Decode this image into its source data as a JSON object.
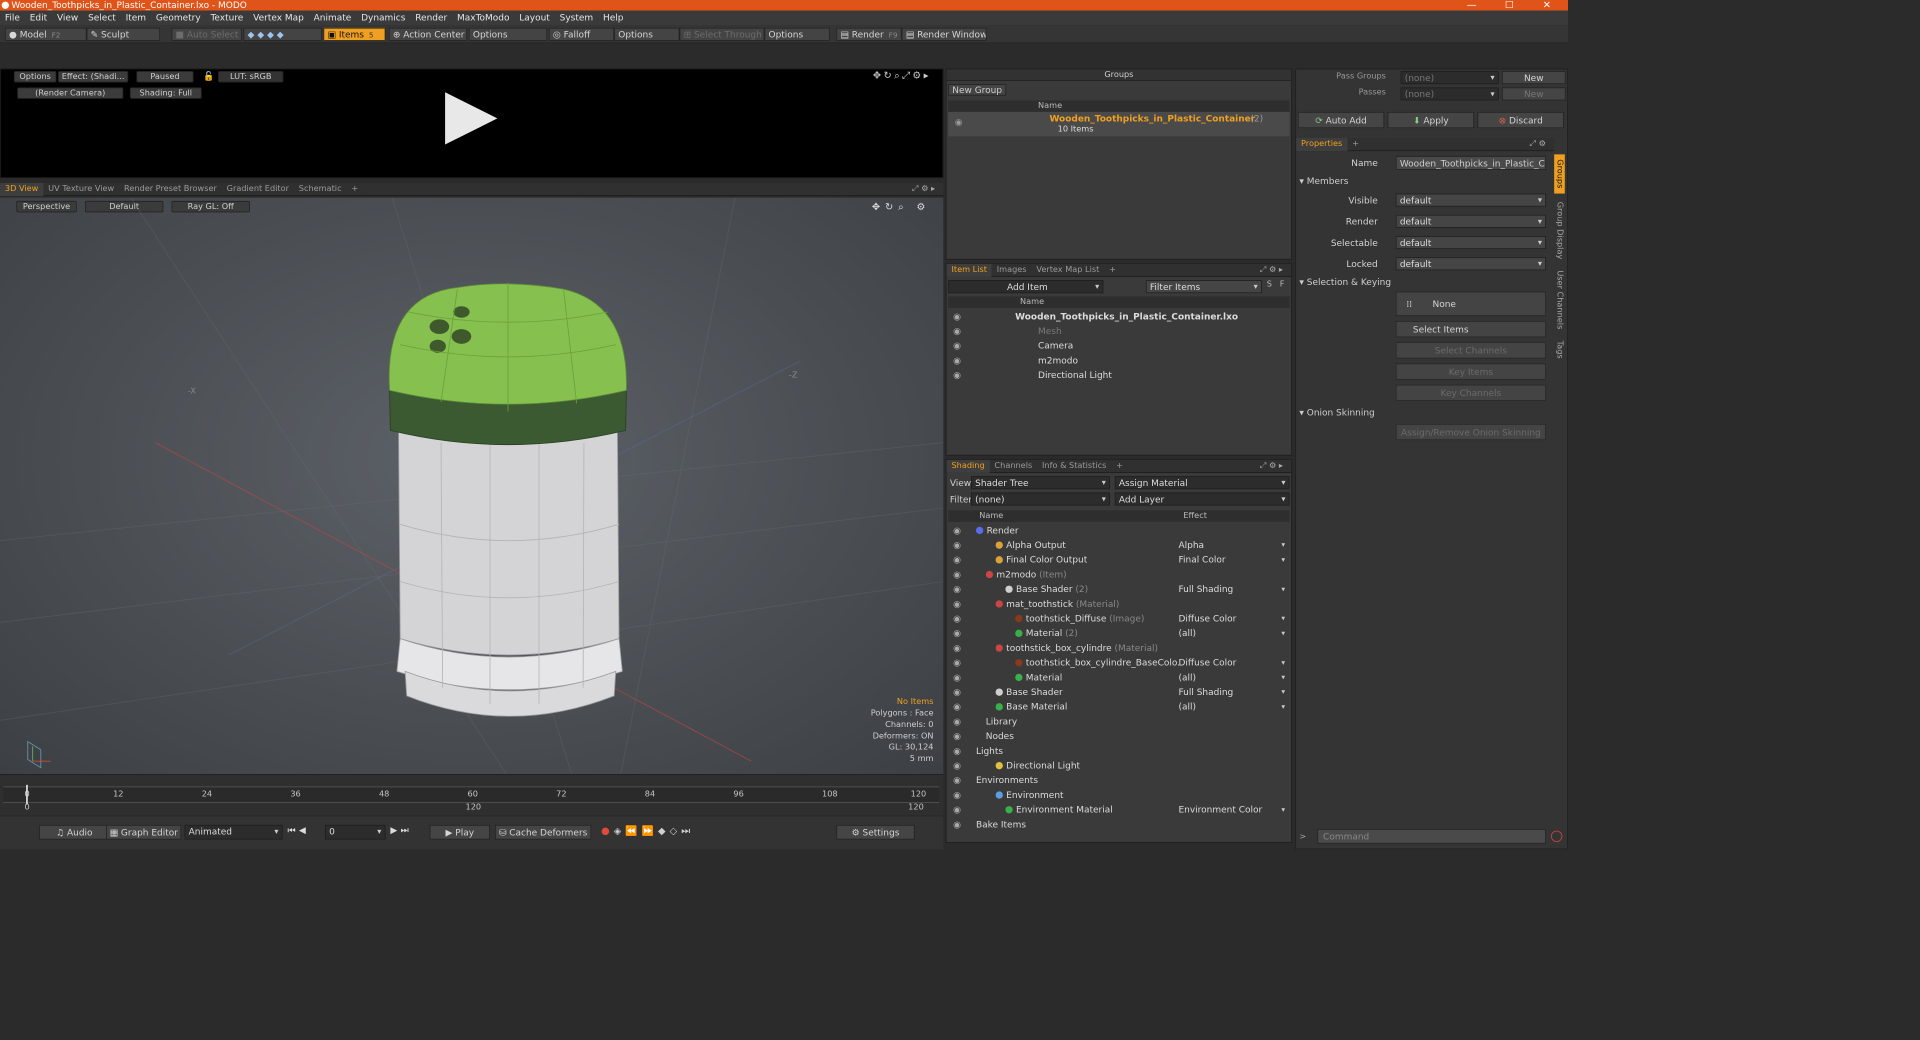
{
  "window": {
    "title": "Wooden_Toothpicks_in_Plastic_Container.lxo - MODO",
    "minimize": "—",
    "maximize": "☐",
    "close": "✕"
  },
  "menu": [
    "File",
    "Edit",
    "View",
    "Select",
    "Item",
    "Geometry",
    "Texture",
    "Vertex Map",
    "Animate",
    "Dynamics",
    "Render",
    "MaxToModo",
    "Layout",
    "System",
    "Help"
  ],
  "toolbar": {
    "model": "Model",
    "model_key": "F2",
    "sculpt": "Sculpt",
    "auto_select": "Auto Select",
    "items": "Items",
    "items_key": "5",
    "action_center": "Action Center",
    "options1": "Options",
    "falloff": "Falloff",
    "options2": "Options",
    "select_through": "Select Through",
    "options3": "Options",
    "render": "Render",
    "render_key": "F9",
    "render_window": "Render Window"
  },
  "preview": {
    "options": "Options",
    "effect": "Effect: (Shadi...",
    "paused": "Paused",
    "lut": "LUT: sRGB",
    "camera": "(Render Camera)",
    "shading": "Shading: Full"
  },
  "viewport": {
    "tabs": [
      "3D View",
      "UV Texture View",
      "Render Preset Browser",
      "Gradient Editor",
      "Schematic",
      "+"
    ],
    "perspective": "Perspective",
    "default": "Default",
    "raygl": "Ray GL: Off",
    "axis_x": "-X",
    "axis_z": "-Z",
    "hud": {
      "no_items": "No Items",
      "polygons": "Polygons : Face",
      "channels": "Channels: 0",
      "deformers": "Deformers: ON",
      "gl": "GL: 30,124",
      "scale": "5 mm"
    }
  },
  "timeline": {
    "ticks": [
      "0",
      "12",
      "24",
      "36",
      "48",
      "60",
      "72",
      "84",
      "96",
      "108",
      "120"
    ],
    "ticks_bottom": [
      "0",
      "120",
      "120"
    ]
  },
  "bottom_bar": {
    "audio": "Audio",
    "graph_editor": "Graph Editor",
    "animated": "Animated",
    "frame": "0",
    "play": "Play",
    "cache": "Cache Deformers",
    "settings": "Settings"
  },
  "groups": {
    "title": "Groups",
    "new_group": "New Group",
    "col_name": "Name",
    "group_name": "Wooden_Toothpicks_in_Plastic_Container",
    "group_count": "(2)",
    "group_items": "10 Items"
  },
  "item_list": {
    "tabs": [
      "Item List",
      "Images",
      "Vertex Map List",
      "+"
    ],
    "add_item": "Add Item",
    "filter": "Filter Items",
    "s": "S",
    "f": "F",
    "col_name": "Name",
    "items": [
      {
        "name": "Wooden_Toothpicks_in_Plastic_Container.lxo",
        "cls": "root"
      },
      {
        "name": "Mesh",
        "cls": "dim"
      },
      {
        "name": "Camera",
        "cls": ""
      },
      {
        "name": "m2modo",
        "cls": ""
      },
      {
        "name": "Directional Light",
        "cls": ""
      }
    ]
  },
  "shading": {
    "tabs": [
      "Shading",
      "Channels",
      "Info & Statistics",
      "+"
    ],
    "view_label": "View",
    "view_value": "Shader Tree",
    "assign": "Assign Material",
    "filter_label": "Filter",
    "filter_value": "(none)",
    "add_layer": "Add Layer",
    "col_name": "Name",
    "col_effect": "Effect",
    "rows": [
      {
        "name": "Render",
        "tag": "",
        "effect": "",
        "indent": 0,
        "color": "#5a6cf0"
      },
      {
        "name": "Alpha Output",
        "tag": "",
        "effect": "Alpha",
        "indent": 2,
        "color": "#d9a23a"
      },
      {
        "name": "Final Color Output",
        "tag": "",
        "effect": "Final Color",
        "indent": 2,
        "color": "#d9a23a"
      },
      {
        "name": "m2modo",
        "tag": "(Item)",
        "effect": "",
        "indent": 1,
        "color": "#c44"
      },
      {
        "name": "Base Shader",
        "tag": "(2)",
        "effect": "Full Shading",
        "indent": 3,
        "color": "#cfcfcf"
      },
      {
        "name": "mat_toothstick",
        "tag": "(Material)",
        "effect": "",
        "indent": 2,
        "color": "#c44"
      },
      {
        "name": "toothstick_Diffuse",
        "tag": "(Image)",
        "effect": "Diffuse Color",
        "indent": 4,
        "color": "#8a3a1a"
      },
      {
        "name": "Material",
        "tag": "(2)",
        "effect": "(all)",
        "indent": 4,
        "color": "#3ab04a"
      },
      {
        "name": "toothstick_box_cylindre",
        "tag": "(Material)",
        "effect": "",
        "indent": 2,
        "color": "#c44"
      },
      {
        "name": "toothstick_box_cylindre_BaseColo...",
        "tag": "",
        "effect": "Diffuse Color",
        "indent": 4,
        "color": "#8a3a1a"
      },
      {
        "name": "Material",
        "tag": "",
        "effect": "(all)",
        "indent": 4,
        "color": "#3ab04a"
      },
      {
        "name": "Base Shader",
        "tag": "",
        "effect": "Full Shading",
        "indent": 2,
        "color": "#cfcfcf"
      },
      {
        "name": "Base Material",
        "tag": "",
        "effect": "(all)",
        "indent": 2,
        "color": "#3ab04a"
      },
      {
        "name": "Library",
        "tag": "",
        "effect": "",
        "indent": 1,
        "color": ""
      },
      {
        "name": "Nodes",
        "tag": "",
        "effect": "",
        "indent": 1,
        "color": ""
      },
      {
        "name": "Lights",
        "tag": "",
        "effect": "",
        "indent": 0,
        "color": ""
      },
      {
        "name": "Directional Light",
        "tag": "",
        "effect": "",
        "indent": 2,
        "color": "#e0c040"
      },
      {
        "name": "Environments",
        "tag": "",
        "effect": "",
        "indent": 0,
        "color": ""
      },
      {
        "name": "Environment",
        "tag": "",
        "effect": "",
        "indent": 2,
        "color": "#5aa0e0"
      },
      {
        "name": "Environment Material",
        "tag": "",
        "effect": "Environment Color",
        "indent": 3,
        "color": "#3ab04a"
      },
      {
        "name": "Bake Items",
        "tag": "",
        "effect": "",
        "indent": 0,
        "color": ""
      }
    ]
  },
  "props": {
    "pass_groups": "Pass Groups",
    "pass_groups_v": "(none)",
    "new1": "New",
    "passes": "Passes",
    "passes_v": "(none)",
    "new2": "New",
    "auto_add": "Auto Add",
    "apply": "Apply",
    "discard": "Discard",
    "tab": "Properties",
    "name_label": "Name",
    "name_value": "Wooden_Toothpicks_in_Plastic_Con",
    "members": "Members",
    "visible": "Visible",
    "render": "Render",
    "selectable": "Selectable",
    "locked": "Locked",
    "dflt": "default",
    "sel_key": "Selection & Keying",
    "none": "None",
    "select_items": "Select Items",
    "select_channels": "Select Channels",
    "key_items": "Key Items",
    "key_channels": "Key Channels",
    "onion": "Onion Skinning",
    "assign_onion": "Assign/Remove Onion Skinning",
    "side_tabs": [
      "Groups",
      "Group Display",
      "User Channels",
      "Tags"
    ],
    "command": "Command"
  }
}
